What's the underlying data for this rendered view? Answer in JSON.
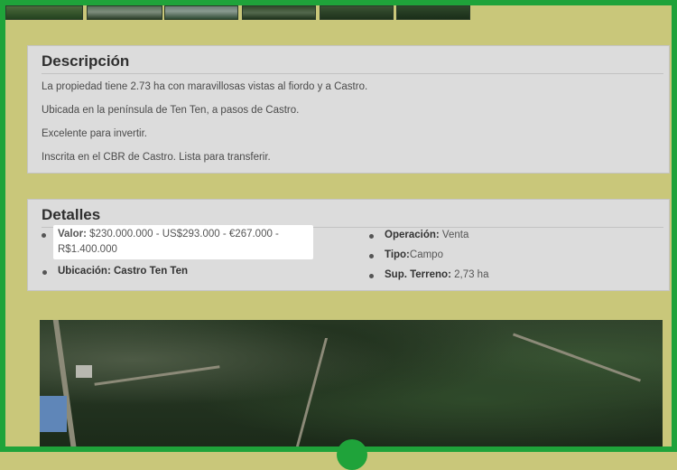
{
  "description": {
    "heading": "Descripción",
    "lines": [
      "La propiedad tiene 2.73 ha con maravillosas vistas al fiordo y a Castro.",
      "Ubicada en la península de Ten Ten, a pasos de Castro.",
      "Excelente para invertir.",
      "Inscrita en el CBR de Castro. Lista para transferir."
    ]
  },
  "details": {
    "heading": "Detalles",
    "valor_label": "Valor:",
    "valor_line1": "$230.000.000 - US$293.000 - €267.000 -",
    "valor_line2": "R$1.400.000",
    "ubicacion_label": "Ubicación:",
    "ubicacion_value": "Castro Ten Ten",
    "operacion_label": "Operación:",
    "operacion_value": "Venta",
    "tipo_label": "Tipo:",
    "tipo_value": "Campo",
    "terreno_label": "Sup. Terreno:",
    "terreno_value": "2,73 ha"
  },
  "colors": {
    "frame": "#1fa33a",
    "background": "#c9c77a",
    "panel": "#dcdcdc"
  }
}
